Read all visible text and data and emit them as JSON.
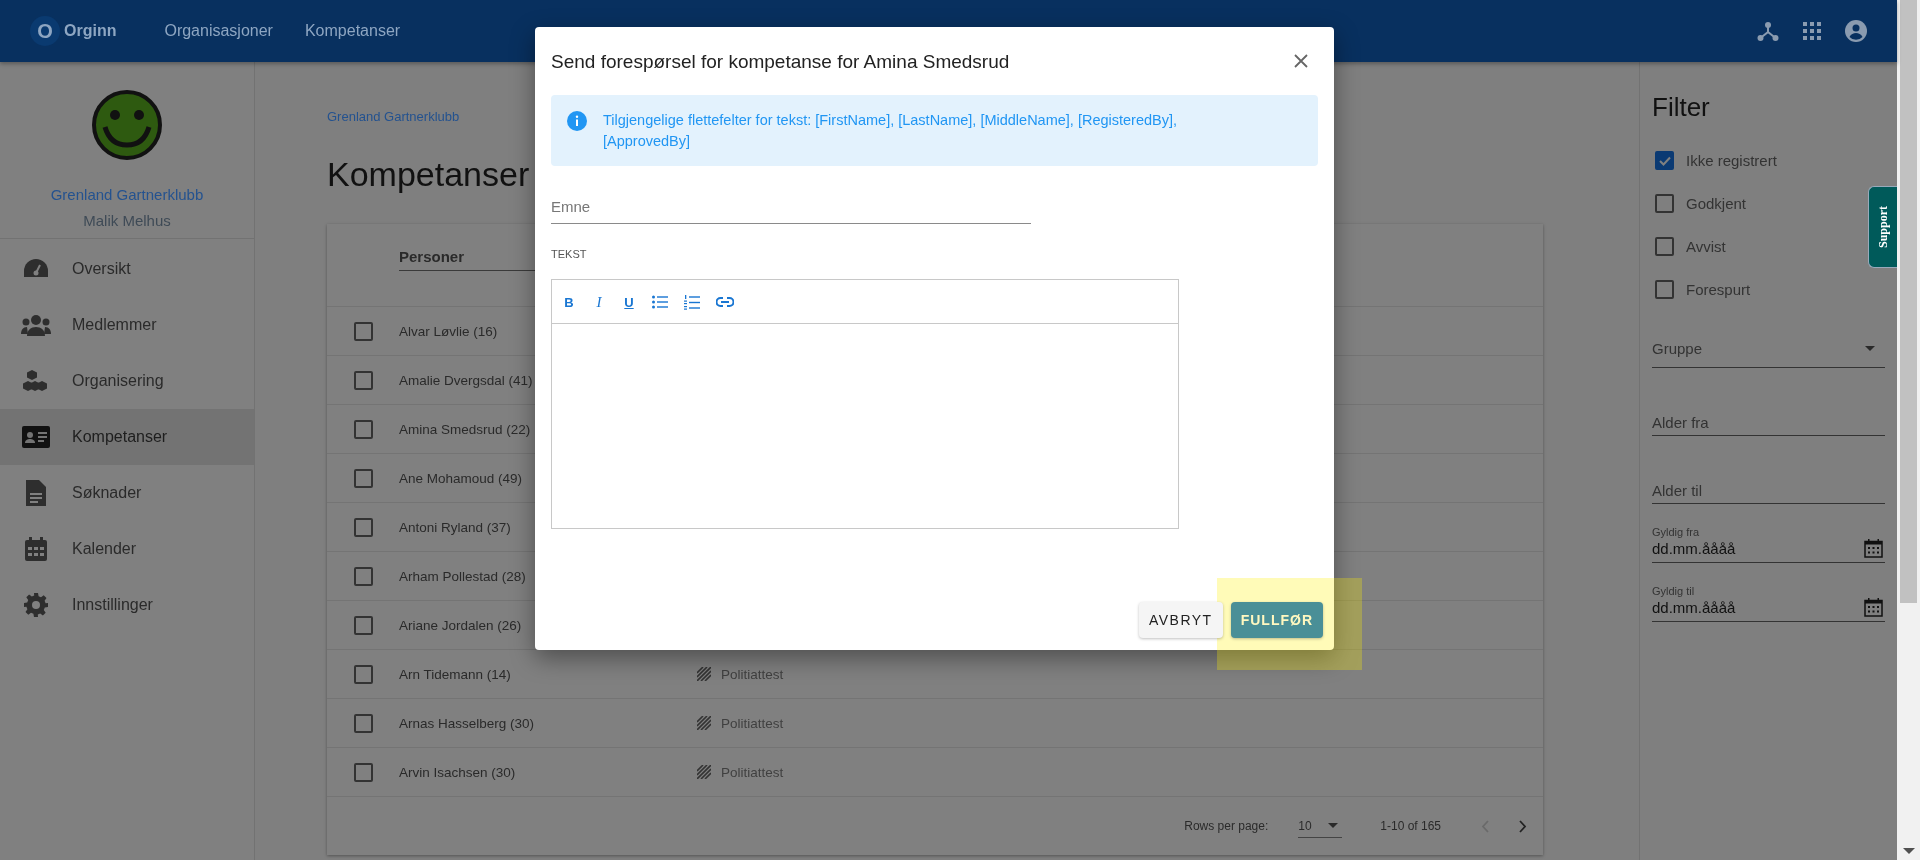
{
  "top_bar": {
    "logo_letter": "O",
    "brand": "Orginn",
    "nav": [
      {
        "label": "Organisasjoner"
      },
      {
        "label": "Kompetanser"
      }
    ]
  },
  "sidebar": {
    "org": "Grenland Gartnerklubb",
    "user": "Malik Melhus",
    "items": [
      {
        "label": "Oversikt",
        "kind": "dashboard",
        "selected": false
      },
      {
        "label": "Medlemmer",
        "kind": "people",
        "selected": false
      },
      {
        "label": "Organisering",
        "kind": "cubes",
        "selected": false
      },
      {
        "label": "Kompetanser",
        "kind": "card",
        "selected": true
      },
      {
        "label": "Søknader",
        "kind": "document",
        "selected": false
      },
      {
        "label": "Kalender",
        "kind": "calendar",
        "selected": false
      },
      {
        "label": "Innstillinger",
        "kind": "gear",
        "selected": false
      }
    ]
  },
  "breadcrumb": "Grenland Gartnerklubb",
  "page_title": "Kompetanser",
  "table": {
    "columns": [
      "Personer"
    ],
    "rows": [
      {
        "name": "Alvar Løvlie (16)",
        "checked": false
      },
      {
        "name": "Amalie Dvergsdal (41)",
        "checked": false
      },
      {
        "name": "Amina Smedsrud (22)",
        "checked": false
      },
      {
        "name": "Ane Mohamoud (49)",
        "checked": false
      },
      {
        "name": "Antoni Ryland (37)",
        "checked": false
      },
      {
        "name": "Arham Pollestad (28)",
        "checked": false
      },
      {
        "name": "Ariane Jordalen (26)",
        "checked": false
      },
      {
        "name": "Arn Tidemann (14)",
        "checked": false,
        "competence": "Politiattest"
      },
      {
        "name": "Arnas Hasselberg (30)",
        "checked": false,
        "competence": "Politiattest"
      },
      {
        "name": "Arvin Isachsen (30)",
        "checked": false,
        "competence": "Politiattest"
      }
    ]
  },
  "pagination": {
    "rows_per_page_label": "Rows per page:",
    "rows_per_page": "10",
    "range": "1-10 of 165",
    "prev": {
      "disabled": true
    },
    "next": {
      "disabled": false
    }
  },
  "filter": {
    "title": "Filter",
    "statuses": [
      {
        "label": "Ikke registrert",
        "checked": true
      },
      {
        "label": "Godkjent",
        "checked": false
      },
      {
        "label": "Avvist",
        "checked": false
      },
      {
        "label": "Forespurt",
        "checked": false
      }
    ],
    "group": {
      "placeholder": "Gruppe"
    },
    "age_fields": [
      {
        "placeholder": "Alder fra"
      },
      {
        "placeholder": "Alder til"
      }
    ],
    "date_fields": [
      {
        "label": "Gyldig fra",
        "placeholder": "dd.mm.åååå"
      },
      {
        "label": "Gyldig til",
        "placeholder": "dd.mm.åååå"
      }
    ]
  },
  "support_tab": "Support",
  "dialog": {
    "title": "Send forespørsel for kompetanse for Amina Smedsrud",
    "info": "Tilgjengelige flettefelter for tekst: [FirstName], [LastName], [MiddleName], [RegisteredBy], [ApprovedBy]",
    "subject": {
      "placeholder": "Emne"
    },
    "text_label": "TEKST",
    "toolbar": [
      {
        "kind": "bold",
        "label": "B"
      },
      {
        "kind": "italic",
        "label": "I"
      },
      {
        "kind": "underline",
        "label": "U"
      },
      {
        "kind": "bullets"
      },
      {
        "kind": "numbers"
      },
      {
        "kind": "link"
      }
    ],
    "buttons": [
      {
        "label": "AVBRYT",
        "kind": "secondary"
      },
      {
        "label": "FULLFØR",
        "kind": "primary"
      }
    ]
  }
}
